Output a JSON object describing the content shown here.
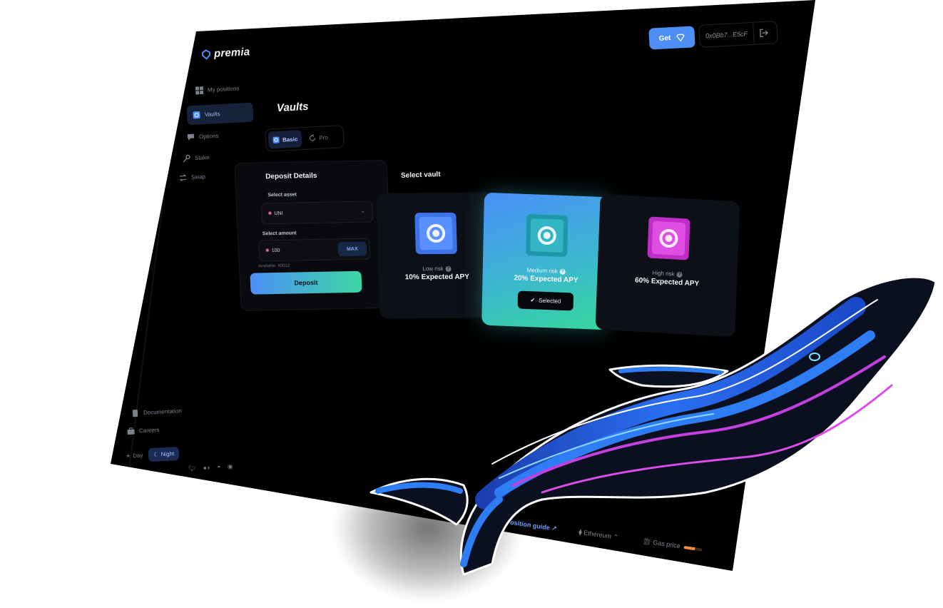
{
  "brand": {
    "name": "premia"
  },
  "sidebar": {
    "items": [
      {
        "label": "My positions",
        "icon": "grid-icon"
      },
      {
        "label": "Vaults",
        "icon": "vault-icon",
        "active": true
      },
      {
        "label": "Options",
        "icon": "chat-icon"
      },
      {
        "label": "Stake",
        "icon": "key-icon"
      },
      {
        "label": "Swap",
        "icon": "swap-icon"
      }
    ],
    "bottom_items": [
      {
        "label": "Documentation",
        "icon": "book-icon"
      },
      {
        "label": "Careers",
        "icon": "briefcase-icon"
      }
    ],
    "theme": {
      "day_label": "Day",
      "night_label": "Night",
      "selected": "Night"
    },
    "social_icons": [
      "twitter-icon",
      "medium-icon",
      "discord-icon",
      "github-icon"
    ]
  },
  "header": {
    "get_label": "Get",
    "wallet_address": "0x0Bb7...E5cF"
  },
  "page": {
    "title": "Vaults",
    "tabs": [
      {
        "label": "Basic",
        "active": true
      },
      {
        "label": "Pro",
        "active": false
      }
    ]
  },
  "deposit": {
    "title": "Deposit Details",
    "asset_label": "Select asset",
    "asset_value": "UNI",
    "amount_label": "Select amount",
    "amount_value": "100",
    "max_label": "MAX",
    "available": "Available: 40012",
    "deposit_label": "Deposit"
  },
  "vaults": {
    "title": "Select vault",
    "options": [
      {
        "risk": "Low risk",
        "apy": "10% Expected APY",
        "color": "#4a7ff0"
      },
      {
        "risk": "Medium risk",
        "apy": "20% Expected APY",
        "color": "#2fb5c7",
        "selected": true
      },
      {
        "risk": "High risk",
        "apy": "60% Expected APY",
        "color": "#d23fd6"
      }
    ],
    "selected_label": "Selected"
  },
  "footer": {
    "position_guide": "Position guide",
    "network": "Ethereum",
    "gas_label": "Gas price",
    "gas_level": 0.6
  },
  "colors": {
    "accent": "#4d8ff7",
    "accent_green": "#3cd8a3",
    "background": "#000000",
    "card": "#0d1016"
  }
}
